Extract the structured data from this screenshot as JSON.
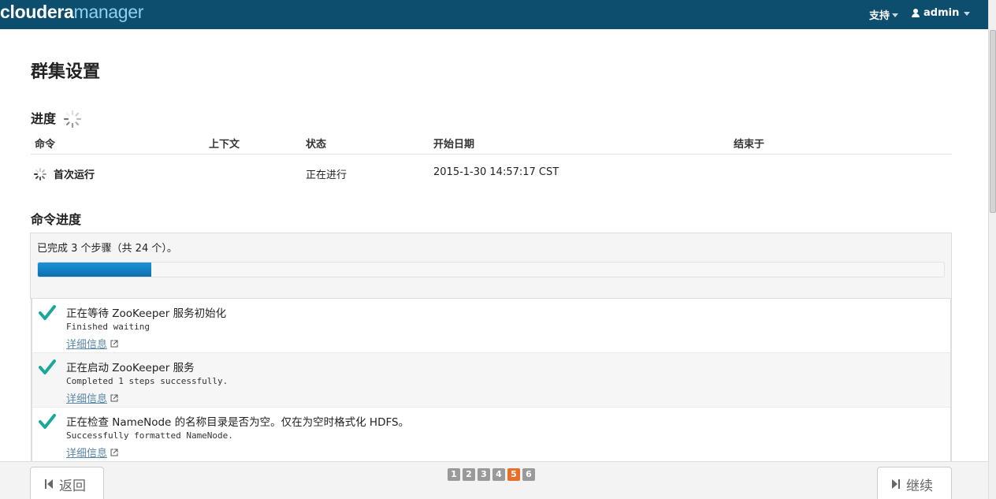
{
  "header": {
    "logo_part1": "cloudera",
    "logo_part2": "manager",
    "support_label": "支持",
    "user_label": "admin"
  },
  "page": {
    "title": "群集设置"
  },
  "progress_section": {
    "title": "进度",
    "columns": [
      "命令",
      "上下文",
      "状态",
      "开始日期",
      "结束于"
    ],
    "row": {
      "command": "首次运行",
      "context": "",
      "status": "正在进行",
      "start_date": "2015-1-30 14:57:17 CST",
      "end": ""
    }
  },
  "command_progress": {
    "title": "命令进度",
    "summary": "已完成 3 个步骤（共 24 个）。",
    "completed_steps": 3,
    "total_steps": 24,
    "steps": [
      {
        "title": "正在等待 ZooKeeper 服务初始化",
        "message": "Finished waiting",
        "link": "详细信息"
      },
      {
        "title": "正在启动 ZooKeeper 服务",
        "message": "Completed 1 steps successfully.",
        "link": "详细信息"
      },
      {
        "title": "正在检查 NameNode 的名称目录是否为空。仅在为空时格式化 HDFS。",
        "message": "Successfully formatted NameNode.",
        "link": "详细信息"
      }
    ]
  },
  "footer": {
    "back_label": "返回",
    "continue_label": "继续",
    "pages": [
      "1",
      "2",
      "3",
      "4",
      "5",
      "6"
    ],
    "current_page": "5"
  },
  "colors": {
    "header_bg": "#0d4d6e",
    "progress_fill": "#1b93d7",
    "check": "#1aa89a",
    "active_page": "#e8702a"
  }
}
